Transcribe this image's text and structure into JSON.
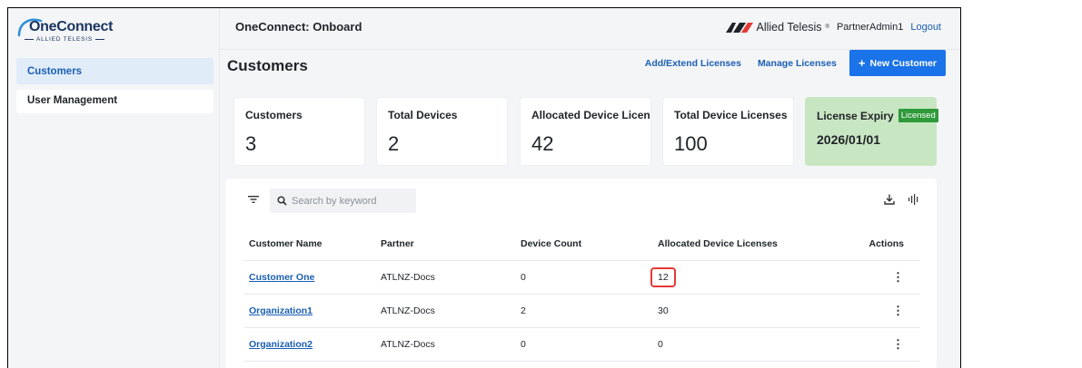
{
  "logo": {
    "word": "OneConnect",
    "sub": "ALLIED TELESIS"
  },
  "sidebar": {
    "items": [
      {
        "label": "Customers",
        "active": true
      },
      {
        "label": "User Management",
        "active": false
      }
    ]
  },
  "header": {
    "app_title": "OneConnect: Onboard",
    "brand": "Allied Telesis",
    "brand_mark": "®",
    "user": "PartnerAdmin1",
    "logout": "Logout"
  },
  "page": {
    "title": "Customers",
    "actions": {
      "add_extend": "Add/Extend Licenses",
      "manage": "Manage Licenses",
      "new_customer": "New Customer",
      "new_customer_icon": "+"
    }
  },
  "stats": [
    {
      "label": "Customers",
      "value": "3"
    },
    {
      "label": "Total Devices",
      "value": "2"
    },
    {
      "label": "Allocated Device Licen...",
      "value": "42"
    },
    {
      "label": "Total Device Licenses",
      "value": "100"
    }
  ],
  "license": {
    "label": "License Expiry",
    "badge": "Licensed",
    "value": "2026/01/01"
  },
  "table": {
    "search_placeholder": "Search by keyword",
    "columns": [
      "Customer Name",
      "Partner",
      "Device Count",
      "Allocated Device Licenses",
      "Actions"
    ],
    "rows": [
      {
        "name": "Customer One",
        "partner": "ATLNZ-Docs",
        "device_count": "0",
        "allocated": "12",
        "actions": "⋮"
      },
      {
        "name": "Organization1",
        "partner": "ATLNZ-Docs",
        "device_count": "2",
        "allocated": "30",
        "actions": "⋮"
      },
      {
        "name": "Organization2",
        "partner": "ATLNZ-Docs",
        "device_count": "0",
        "allocated": "0",
        "actions": "⋮"
      }
    ]
  },
  "colors": {
    "accent": "#1a73e8",
    "link": "#1a5fb4",
    "license_bg": "#c9e6c2",
    "badge": "#2e9a3a",
    "highlight": "#e53935"
  },
  "icons": [
    "filter-icon",
    "search-icon",
    "download-icon",
    "columns-icon",
    "kebab-icon",
    "allied-telesis-logo-icon"
  ]
}
